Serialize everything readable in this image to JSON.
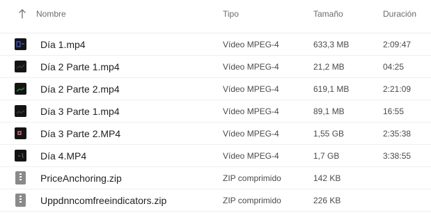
{
  "columns": {
    "name": "Nombre",
    "type": "Tipo",
    "size": "Tamaño",
    "duration": "Duración"
  },
  "sort": {
    "icon": "arrow-up-icon",
    "direction": "ascending"
  },
  "files": [
    {
      "name": "Día 1.mp4",
      "type": "Vídeo MPEG-4",
      "size": "633,3 MB",
      "duration": "2:09:47",
      "icon": "video-thumbnail",
      "accent": "#3b54c7"
    },
    {
      "name": "Día 2 Parte 1.mp4",
      "type": "Vídeo MPEG-4",
      "size": "21,2 MB",
      "duration": "04:25",
      "icon": "video-thumbnail",
      "accent": "#3d3d3d"
    },
    {
      "name": "Día 2 Parte 2.mp4",
      "type": "Vídeo MPEG-4",
      "size": "619,1 MB",
      "duration": "2:21:09",
      "icon": "video-thumbnail",
      "accent": "#2f8f3a"
    },
    {
      "name": "Día 3 Parte 1.mp4",
      "type": "Vídeo MPEG-4",
      "size": "89,1 MB",
      "duration": "16:55",
      "icon": "video-thumbnail",
      "accent": "#3a3a3a"
    },
    {
      "name": "Día 3 Parte 2.MP4",
      "type": "Vídeo MPEG-4",
      "size": "1,55 GB",
      "duration": "2:35:38",
      "icon": "video-thumbnail",
      "accent": "#e26b7a"
    },
    {
      "name": "Día 4.MP4",
      "type": "Vídeo MPEG-4",
      "size": "1,7 GB",
      "duration": "3:38:55",
      "icon": "video-thumbnail",
      "accent": "#5a5a5a"
    },
    {
      "name": "PriceAnchoring.zip",
      "type": "ZIP comprimido",
      "size": "142 KB",
      "duration": "",
      "icon": "zip-archive-icon",
      "accent": "#8a8a8a"
    },
    {
      "name": "Uppdnncomfreeindicators.zip",
      "type": "ZIP comprimido",
      "size": "226 KB",
      "duration": "",
      "icon": "zip-archive-icon",
      "accent": "#8a8a8a"
    }
  ]
}
